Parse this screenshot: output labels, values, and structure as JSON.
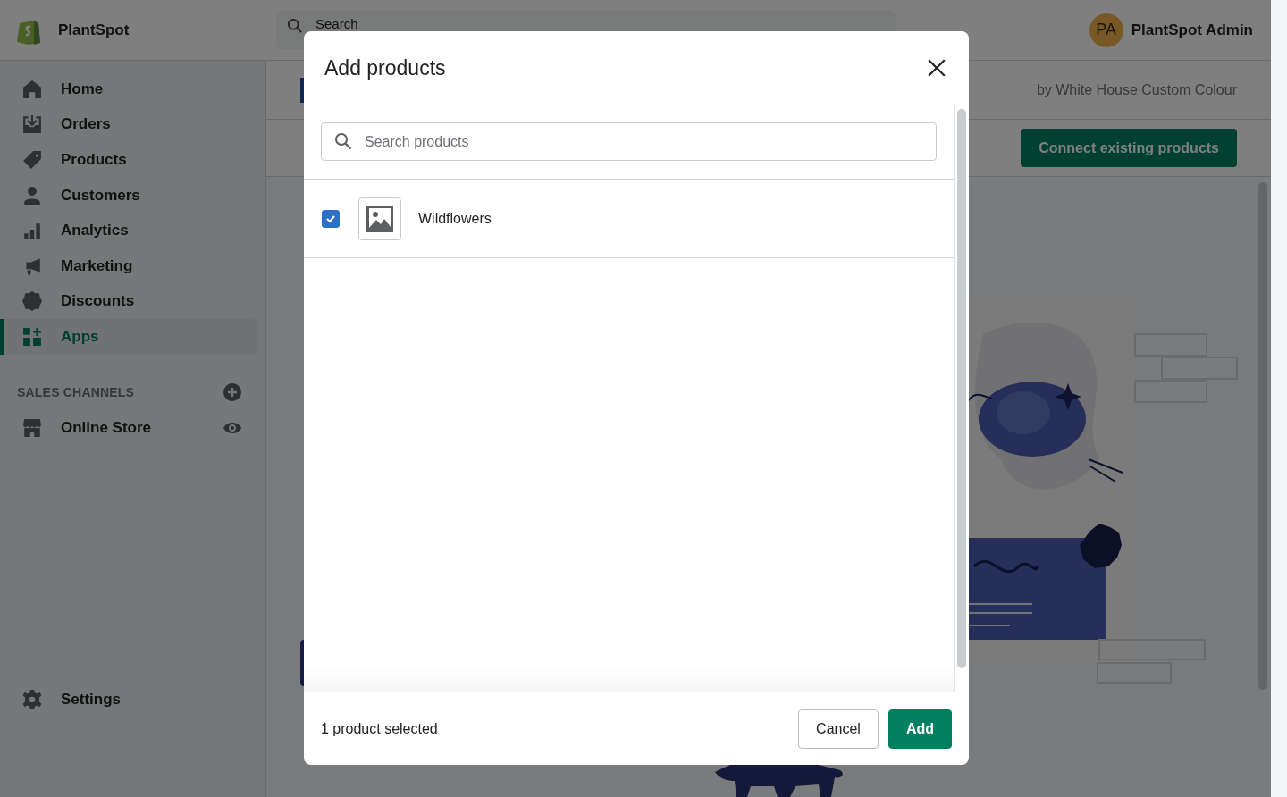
{
  "topbar": {
    "store_name": "PlantSpot",
    "search": {
      "placeholder": "Search"
    },
    "account": {
      "initials": "PA",
      "name": "PlantSpot Admin"
    }
  },
  "sidebar": {
    "items": [
      {
        "label": "Home",
        "selected": false
      },
      {
        "label": "Orders",
        "selected": false
      },
      {
        "label": "Products",
        "selected": false
      },
      {
        "label": "Customers",
        "selected": false
      },
      {
        "label": "Analytics",
        "selected": false
      },
      {
        "label": "Marketing",
        "selected": false
      },
      {
        "label": "Discounts",
        "selected": false
      },
      {
        "label": "Apps",
        "selected": true
      }
    ],
    "sales_channels": {
      "heading": "SALES CHANNELS",
      "items": [
        {
          "label": "Online Store"
        }
      ]
    },
    "settings": {
      "label": "Settings"
    }
  },
  "page": {
    "vendor": "by White House Custom Colour",
    "primary_action": "Connect existing products"
  },
  "modal": {
    "title": "Add products",
    "search": {
      "placeholder": "Search products"
    },
    "products": [
      {
        "name": "Wildflowers",
        "checked": true
      }
    ],
    "selection_count": "1 product selected",
    "buttons": [
      {
        "label": "Cancel",
        "kind": "secondary"
      },
      {
        "label": "Add",
        "kind": "primary"
      }
    ]
  }
}
